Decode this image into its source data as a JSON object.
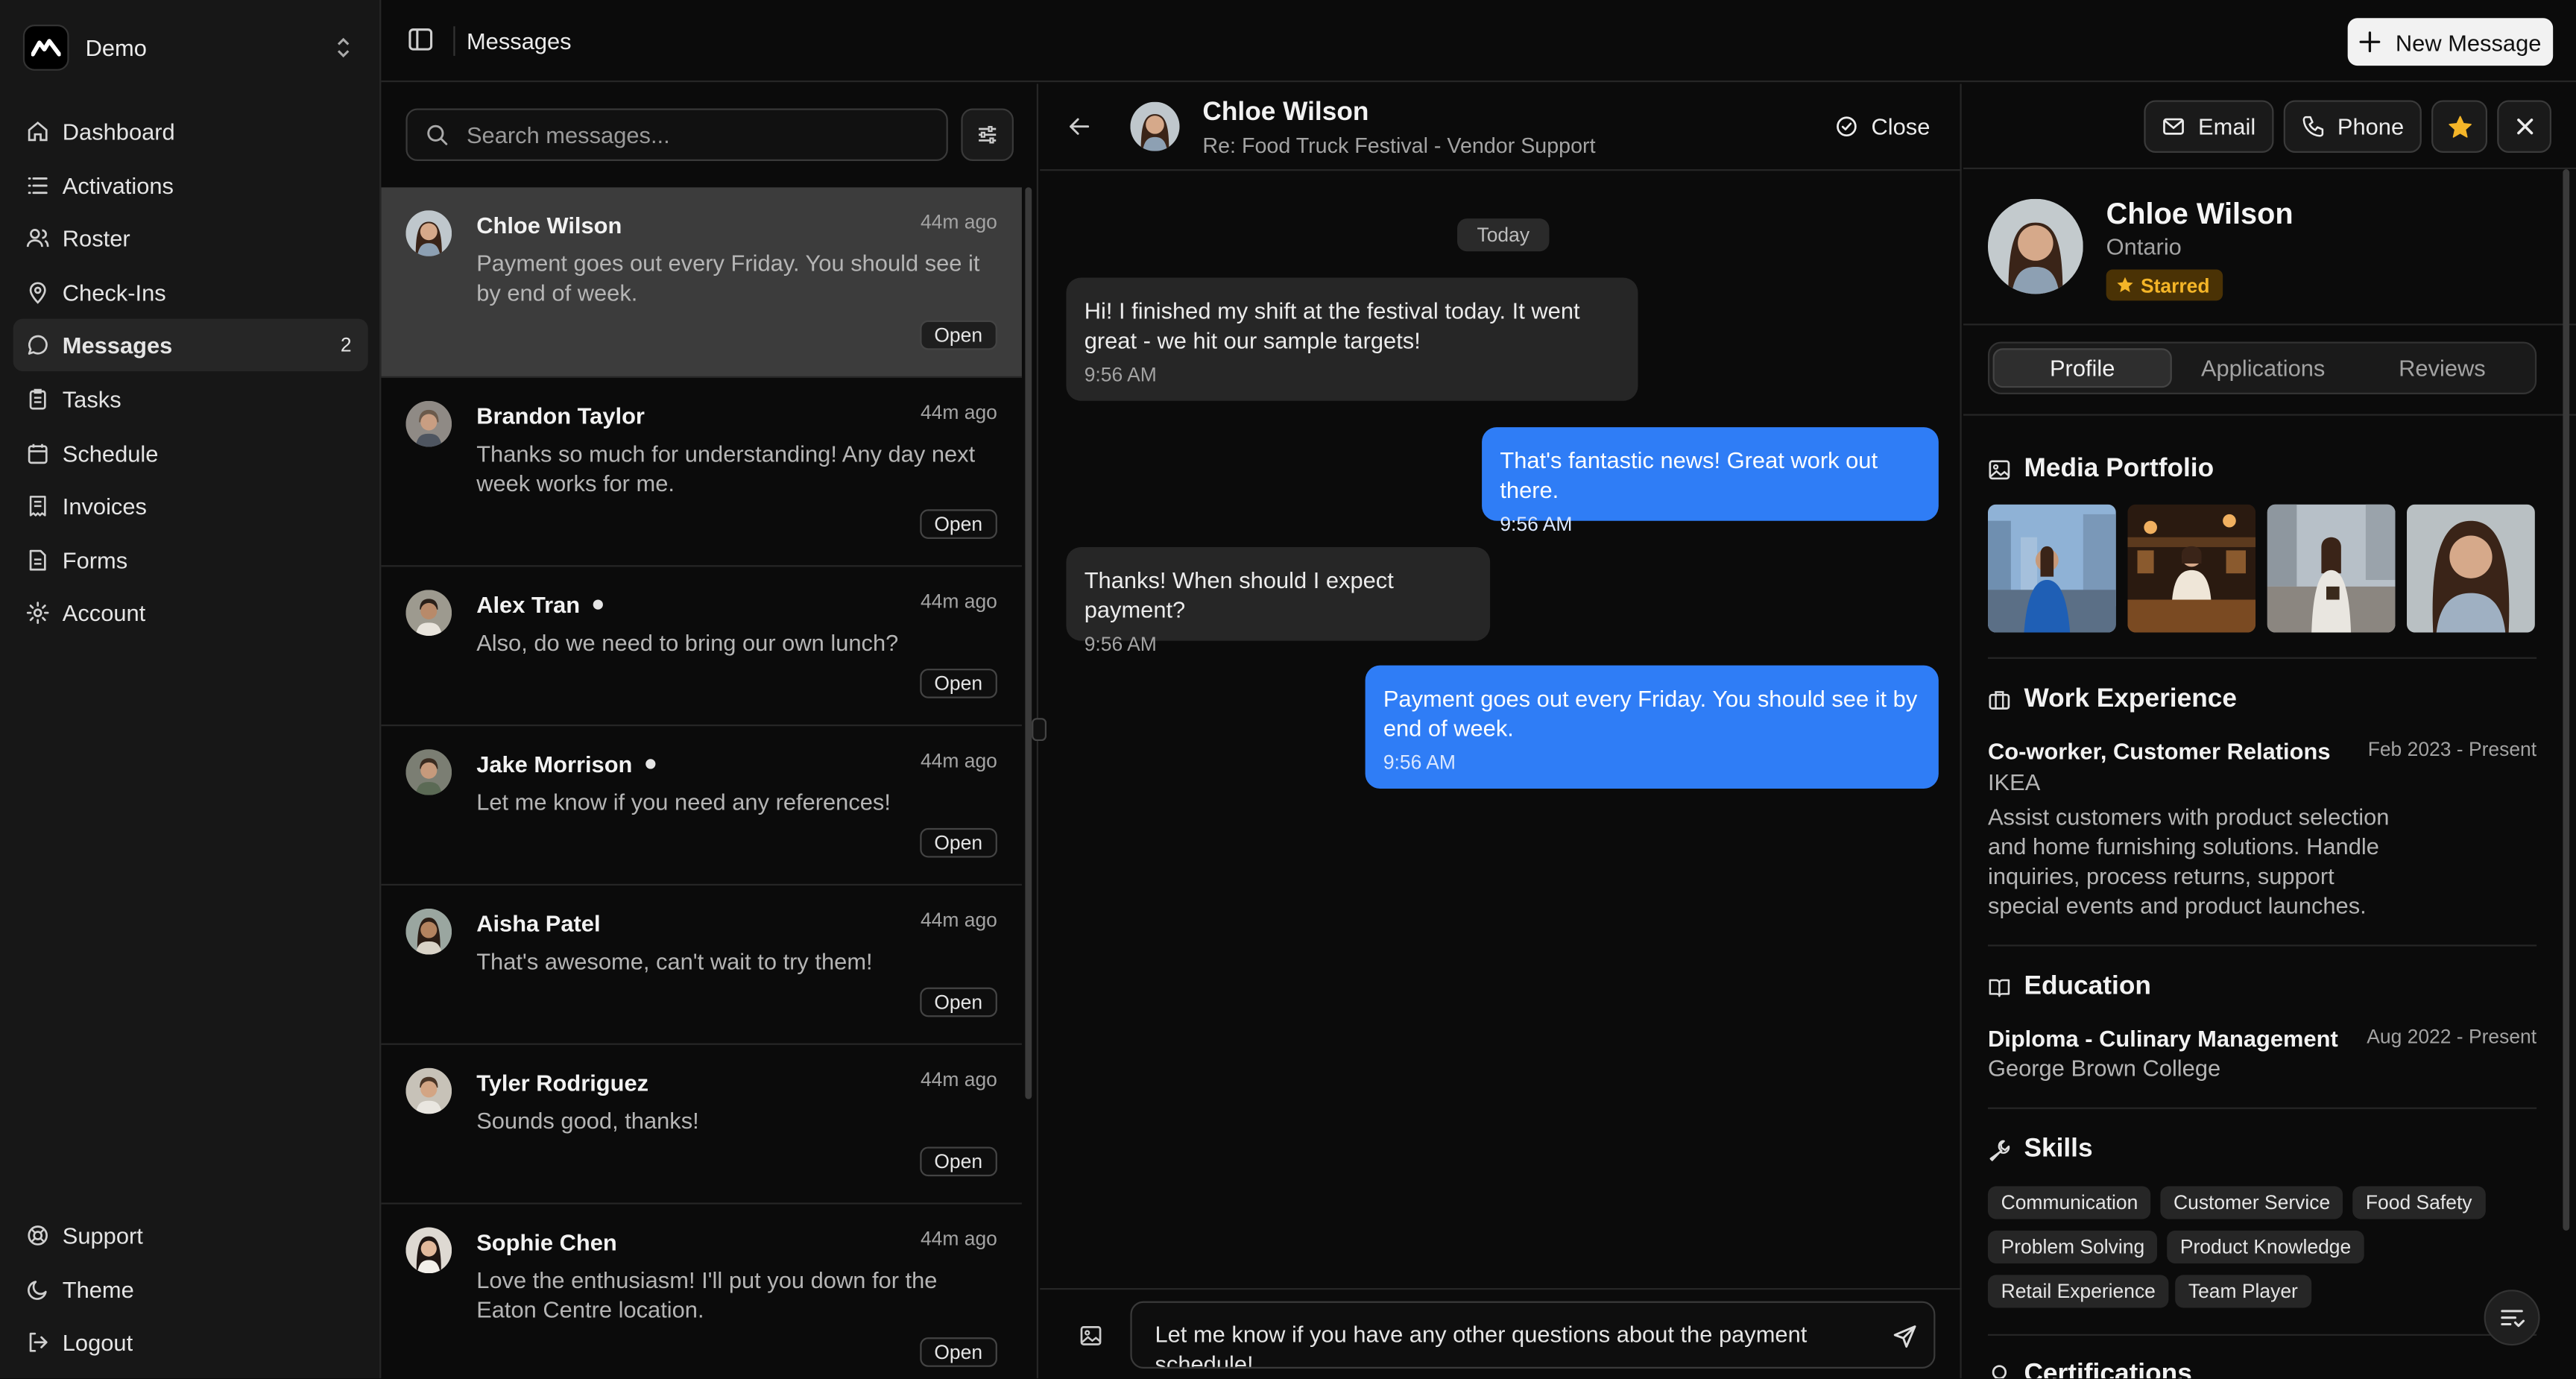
{
  "workspace": {
    "name": "Demo"
  },
  "nav": {
    "items": [
      {
        "label": "Dashboard",
        "icon": "home-icon"
      },
      {
        "label": "Activations",
        "icon": "list-icon"
      },
      {
        "label": "Roster",
        "icon": "users-icon"
      },
      {
        "label": "Check-Ins",
        "icon": "map-pin-icon"
      },
      {
        "label": "Messages",
        "icon": "message-circle-icon",
        "badge": "2",
        "active": true
      },
      {
        "label": "Tasks",
        "icon": "clipboard-icon"
      },
      {
        "label": "Schedule",
        "icon": "calendar-icon"
      },
      {
        "label": "Invoices",
        "icon": "receipt-icon"
      },
      {
        "label": "Forms",
        "icon": "file-text-icon"
      },
      {
        "label": "Account",
        "icon": "gear-icon"
      }
    ],
    "bottom": [
      {
        "label": "Support",
        "icon": "life-buoy-icon"
      },
      {
        "label": "Theme",
        "icon": "moon-icon"
      },
      {
        "label": "Logout",
        "icon": "log-out-icon"
      }
    ]
  },
  "header": {
    "title": "Messages",
    "new_message_label": "New Message"
  },
  "search": {
    "placeholder": "Search messages..."
  },
  "threads": [
    {
      "name": "Chloe Wilson",
      "time": "44m ago",
      "preview": "Payment goes out every Friday. You should see it by end of week.",
      "status": "Open",
      "selected": true,
      "unread": false
    },
    {
      "name": "Brandon Taylor",
      "time": "44m ago",
      "preview": "Thanks so much for understanding! Any day next week works for me.",
      "status": "Open",
      "unread": false
    },
    {
      "name": "Alex Tran",
      "time": "44m ago",
      "preview": "Also, do we need to bring our own lunch?",
      "status": "Open",
      "unread": true
    },
    {
      "name": "Jake Morrison",
      "time": "44m ago",
      "preview": "Let me know if you need any references!",
      "status": "Open",
      "unread": true
    },
    {
      "name": "Aisha Patel",
      "time": "44m ago",
      "preview": "That's awesome, can't wait to try them!",
      "status": "Open",
      "unread": false
    },
    {
      "name": "Tyler Rodriguez",
      "time": "44m ago",
      "preview": "Sounds good, thanks!",
      "status": "Open",
      "unread": false
    },
    {
      "name": "Sophie Chen",
      "time": "44m ago",
      "preview": "Love the enthusiasm! I'll put you down for the Eaton Centre location.",
      "status": "Open",
      "unread": false
    }
  ],
  "chat": {
    "name": "Chloe Wilson",
    "subject": "Re: Food Truck Festival - Vendor Support",
    "close_label": "Close",
    "day_label": "Today",
    "messages": [
      {
        "dir": "in",
        "text": "Hi! I finished my shift at the festival today. It went great - we hit our sample targets!",
        "time": "9:56 AM"
      },
      {
        "dir": "out",
        "text": "That's fantastic news! Great work out there.",
        "time": "9:56 AM"
      },
      {
        "dir": "in",
        "text": "Thanks! When should I expect payment?",
        "time": "9:56 AM"
      },
      {
        "dir": "out",
        "text": "Payment goes out every Friday. You should see it by end of week.",
        "time": "9:56 AM"
      }
    ],
    "draft": "Let me know if you have any other questions about the payment schedule!"
  },
  "profile": {
    "name": "Chloe Wilson",
    "location": "Ontario",
    "badge": "Starred",
    "email_label": "Email",
    "phone_label": "Phone",
    "tabs": [
      "Profile",
      "Applications",
      "Reviews"
    ],
    "media_title": "Media Portfolio",
    "work_title": "Work Experience",
    "work": {
      "role": "Co-worker, Customer Relations",
      "org": "IKEA",
      "dates": "Feb 2023 - Present",
      "desc": "Assist customers with product selection and home furnishing solutions. Handle inquiries, process returns, support special events and product launches."
    },
    "edu_title": "Education",
    "edu": {
      "degree": "Diploma - Culinary Management",
      "school": "George Brown College",
      "dates": "Aug 2022 - Present"
    },
    "skills_title": "Skills",
    "skills": [
      "Communication",
      "Customer Service",
      "Food Safety",
      "Problem Solving",
      "Product Knowledge",
      "Retail Experience",
      "Team Player"
    ],
    "cert_title": "Certifications"
  },
  "colors": {
    "accent": "#2f7df6",
    "star": "#f4b528",
    "background": "#0b0b0b"
  }
}
